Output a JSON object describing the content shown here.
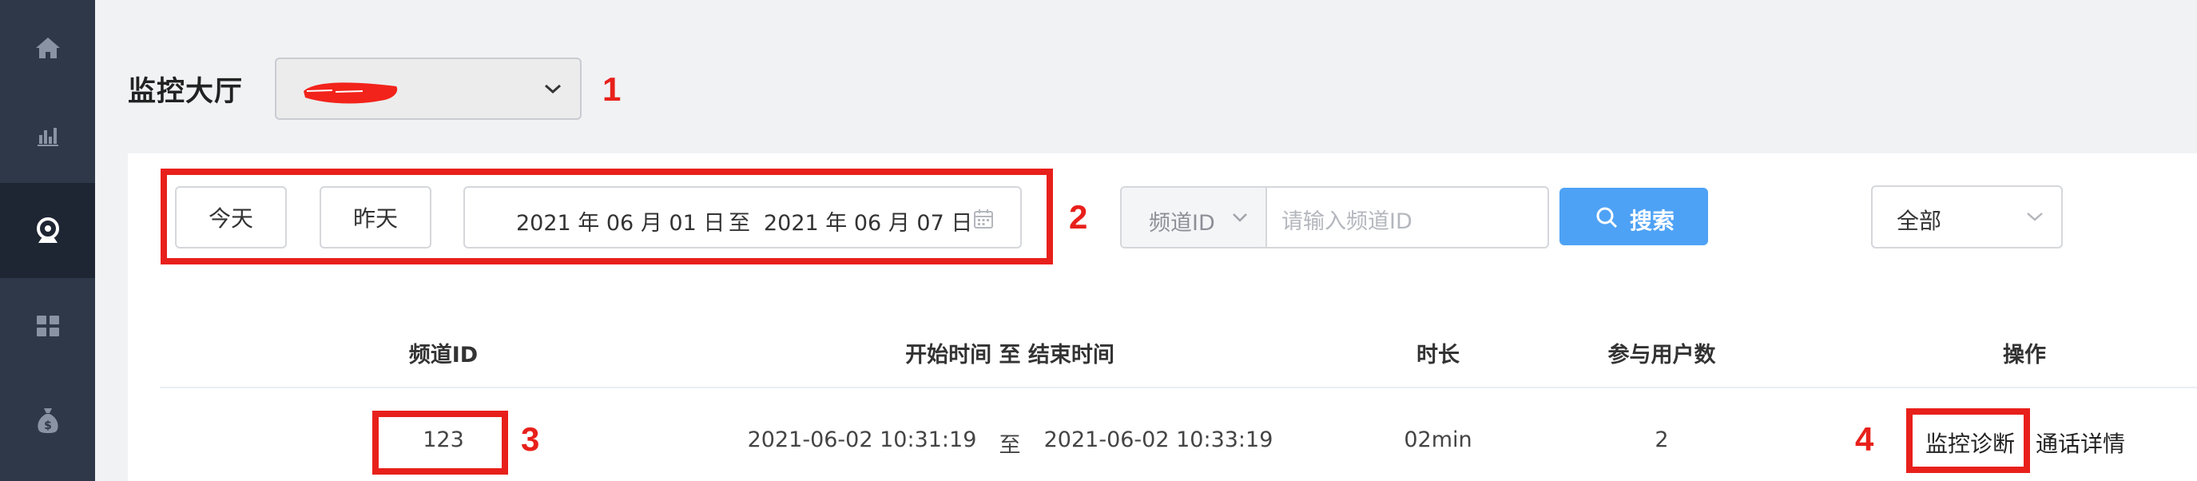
{
  "sidebar": {
    "items": [
      {
        "icon": "home-icon"
      },
      {
        "icon": "bar-chart-icon"
      },
      {
        "icon": "webcam-icon",
        "active": true
      },
      {
        "icon": "grid-icon"
      },
      {
        "icon": "money-bag-icon"
      }
    ]
  },
  "header": {
    "title": "监控大厅",
    "org_select": {
      "value": "(redacted)"
    }
  },
  "annotations": [
    "1",
    "2",
    "3",
    "4"
  ],
  "filters": {
    "today_label": "今天",
    "yesterday_label": "昨天",
    "date_range": {
      "start": "2021 年 06 月 01 日",
      "separator": "至",
      "end": "2021 年 06 月 07 日"
    },
    "search_field": {
      "prefix": "频道ID",
      "placeholder": "请输入频道ID"
    },
    "search_button": "搜索",
    "status_select": "全部"
  },
  "table": {
    "columns": [
      "频道ID",
      "开始时间 至 结束时间",
      "时长",
      "参与用户数",
      "操作"
    ],
    "rows": [
      {
        "channel_id": "123",
        "start_time": "2021-06-02 10:31:19",
        "to": "至",
        "end_time": "2021-06-02 10:33:19",
        "duration": "02min",
        "participants": "2",
        "actions": [
          "监控诊断",
          "通话详情"
        ]
      }
    ]
  },
  "colors": {
    "sidebar_bg": "#2e3848",
    "sidebar_active_bg": "#1f2633",
    "primary": "#4ea2f5",
    "annotation_red": "#e8201b"
  }
}
